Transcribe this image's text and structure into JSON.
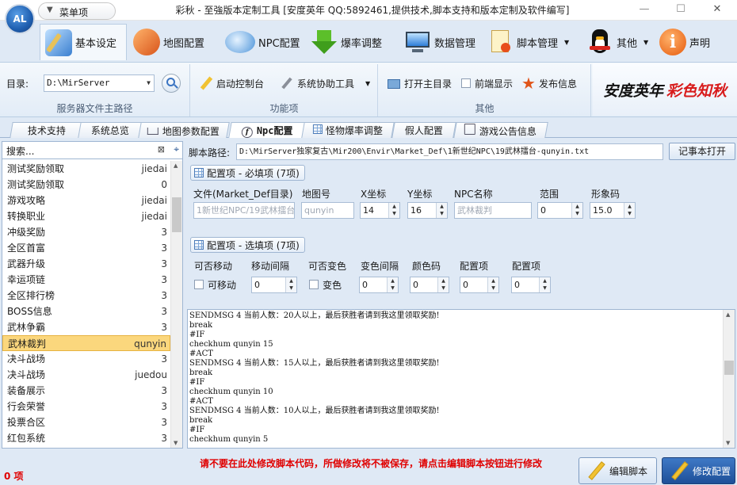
{
  "window": {
    "title": "彩秋 - 至強版本定制工具 [安度英年 QQ:5892461,提供技术,脚本支持和版本定制及软件编写]",
    "logo_text": "AL",
    "menu_label": "菜单项"
  },
  "ribbon_tabs": [
    {
      "label": "基本设定",
      "icon": "settings-pen-icon"
    },
    {
      "label": "地图配置",
      "icon": "map-icon"
    },
    {
      "label": "NPC配置",
      "icon": "chat-bubble-icon"
    },
    {
      "label": "爆率调整",
      "icon": "download-arrow-icon"
    },
    {
      "label": "数据管理",
      "icon": "monitor-icon"
    },
    {
      "label": "脚本管理",
      "icon": "document-icon"
    },
    {
      "label": "其他",
      "icon": "penguin-icon"
    },
    {
      "label": "声明",
      "icon": "info-icon"
    }
  ],
  "ribbon": {
    "dir_label": "目录:",
    "dir_value": "D:\\MirServer",
    "group1_caption": "服务器文件主路径",
    "start_console": "启动控制台",
    "sys_tools": "系统协助工具",
    "group2_caption": "功能项",
    "open_main_dir": "打开主目录",
    "front_display": "前端显示",
    "publish_info": "发布信息",
    "group3_caption": "其他",
    "brand_black": "安度英年",
    "brand_red": "彩色知秋"
  },
  "doc_tabs": [
    "技术支持",
    "系统总览",
    "地图参数配置",
    "Npc配置",
    "怪物爆率调整",
    "假人配置",
    "游戏公告信息"
  ],
  "search": {
    "placeholder": "搜索..."
  },
  "npc_list": [
    {
      "name": "测试奖励领取",
      "val": "jiedai"
    },
    {
      "name": "测试奖励领取",
      "val": "0"
    },
    {
      "name": "游戏攻略",
      "val": "jiedai"
    },
    {
      "name": "转换职业",
      "val": "jiedai"
    },
    {
      "name": "冲级奖励",
      "val": "3"
    },
    {
      "name": "全区首富",
      "val": "3"
    },
    {
      "name": "武器升级",
      "val": "3"
    },
    {
      "name": "幸运项链",
      "val": "3"
    },
    {
      "name": "全区排行榜",
      "val": "3"
    },
    {
      "name": "BOSS信息",
      "val": "3"
    },
    {
      "name": "武林争霸",
      "val": "3"
    },
    {
      "name": "武林裁判",
      "val": "qunyin"
    },
    {
      "name": "决斗战场",
      "val": "3"
    },
    {
      "name": "决斗战场",
      "val": "juedou"
    },
    {
      "name": "装备展示",
      "val": "3"
    },
    {
      "name": "行会荣誉",
      "val": "3"
    },
    {
      "name": "投票合区",
      "val": "3"
    },
    {
      "name": "红包系统",
      "val": "3"
    }
  ],
  "selected_index": 11,
  "script_path": {
    "label": "脚本路径:",
    "value": "D:\\MirServer独家复古\\Mir200\\Envir\\Market_Def\\1新世纪NPC\\19武林擂台-qunyin.txt",
    "notepad_button": "记事本打开"
  },
  "required": {
    "title": "配置项 - 必填项 (7项)",
    "labels": [
      "文件(Market_Def目录)",
      "地图号",
      "X坐标",
      "Y坐标",
      "NPC名称",
      "范围",
      "形象码"
    ],
    "file": "1新世纪NPC/19武林擂台",
    "map": "qunyin",
    "x": "14",
    "y": "16",
    "npc_name": "武林裁判",
    "range": "0",
    "shape": "15.0"
  },
  "optional": {
    "title": "配置项 - 选填项 (7项)",
    "labels": [
      "可否移动",
      "移动间隔",
      "可否变色",
      "变色间隔",
      "颜色码",
      "配置项",
      "配置项"
    ],
    "movable_label": "可移动",
    "color_label": "变色",
    "move_interval": "0",
    "color_interval": "0",
    "color_code": "0",
    "opt1": "0",
    "opt2": "0"
  },
  "script_lines": [
    "SENDMSG 4 当前人数：20人以上，最后获胜者请到我这里领取奖励!",
    "break",
    "#IF",
    "checkhum qunyin 15",
    "#ACT",
    "SENDMSG 4 当前人数：15人以上，最后获胜者请到我这里领取奖励!",
    "break",
    "#IF",
    "checkhum qunyin 10",
    "#ACT",
    "SENDMSG 4 当前人数：10人以上，最后获胜者请到我这里领取奖励!",
    "break",
    "#IF",
    "checkhum qunyin 5"
  ],
  "footer": {
    "count": "0 项",
    "warning": "请不要在此处修改脚本代码，所做修改将不被保存，请点击编辑脚本按钮进行修改",
    "edit_button": "编辑脚本",
    "modify_button": "修改配置"
  },
  "colors": {
    "accent": "#1f5fb0",
    "warning": "#e00000",
    "selection": "#fbd77d",
    "brand_red": "#d81b1b"
  }
}
